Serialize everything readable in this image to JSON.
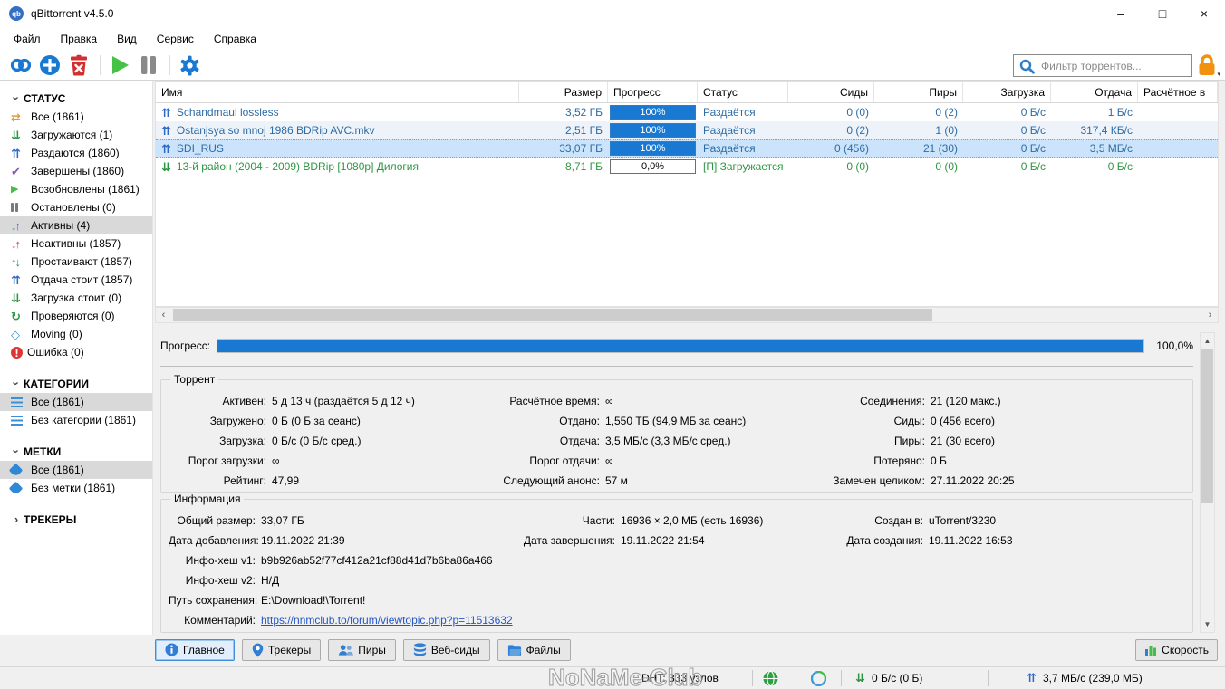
{
  "colors": {
    "accent": "#1878d2",
    "selection": "#cce4fb",
    "seeding_text": "#2d6ca5",
    "downloading_text": "#2e9642",
    "lock": "#f0920e"
  },
  "titlebar": {
    "title": "qBittorrent v4.5.0",
    "minimize": "–",
    "maximize": "□",
    "close": "×"
  },
  "menu": {
    "items": [
      "Файл",
      "Правка",
      "Вид",
      "Сервис",
      "Справка"
    ]
  },
  "toolbar": {
    "filter_placeholder": "Фильтр торрентов..."
  },
  "sidebar": {
    "status_header": "СТАТУС",
    "categories_header": "КАТЕГОРИИ",
    "tags_header": "МЕТКИ",
    "trackers_header": "ТРЕКЕРЫ",
    "status_items": [
      {
        "icon": "shuffle",
        "label": "Все (1861)"
      },
      {
        "icon": "chevrons-down",
        "label": "Загружаются (1)"
      },
      {
        "icon": "chevrons-up",
        "label": "Раздаются (1860)"
      },
      {
        "icon": "check",
        "label": "Завершены (1860)"
      },
      {
        "icon": "play",
        "label": "Возобновлены (1861)"
      },
      {
        "icon": "pause",
        "label": "Остановлены (0)"
      },
      {
        "icon": "arrows-active",
        "label": "Активны (4)",
        "selected": true
      },
      {
        "icon": "arrows-inactive",
        "label": "Неактивны (1857)"
      },
      {
        "icon": "arrows-idle",
        "label": "Простаивают (1857)"
      },
      {
        "icon": "chevrons-up",
        "label": "Отдача стоит (1857)"
      },
      {
        "icon": "chevrons-down",
        "label": "Загрузка стоит (0)"
      },
      {
        "icon": "refresh",
        "label": "Проверяются (0)"
      },
      {
        "icon": "diamond",
        "label": "Moving (0)"
      },
      {
        "icon": "error",
        "label": "Ошибка (0)"
      }
    ],
    "category_items": [
      {
        "icon": "list",
        "label": "Все (1861)",
        "selected": true
      },
      {
        "icon": "list",
        "label": "Без категории (1861)"
      }
    ],
    "tag_items": [
      {
        "icon": "tag",
        "label": "Все (1861)",
        "selected": true
      },
      {
        "icon": "tag",
        "label": "Без метки (1861)"
      }
    ]
  },
  "table": {
    "columns": [
      "Имя",
      "Размер",
      "Прогресс",
      "Статус",
      "Сиды",
      "Пиры",
      "Загрузка",
      "Отдача",
      "Расчётное в"
    ],
    "rows": [
      {
        "name": "Schandmaul lossless",
        "size": "3,52 ГБ",
        "progress": "100%",
        "status": "Раздаётся",
        "seeds": "0 (0)",
        "peers": "0 (2)",
        "down": "0 Б/с",
        "up": "1 Б/с",
        "eta": ""
      },
      {
        "name": "Ostanjsya so mnoj 1986 BDRip AVC.mkv",
        "size": "2,51 ГБ",
        "progress": "100%",
        "status": "Раздаётся",
        "seeds": "0 (2)",
        "peers": "1 (0)",
        "down": "0 Б/с",
        "up": "317,4 КБ/с",
        "eta": ""
      },
      {
        "name": "SDI_RUS",
        "size": "33,07 ГБ",
        "progress": "100%",
        "status": "Раздаётся",
        "seeds": "0 (456)",
        "peers": "21 (30)",
        "down": "0 Б/с",
        "up": "3,5 МБ/с",
        "eta": ""
      },
      {
        "name": "13-й район (2004 - 2009) BDRip [1080p] Дилогия",
        "size": "8,71 ГБ",
        "progress": "0,0%",
        "status": "[П] Загружается",
        "seeds": "0 (0)",
        "peers": "0 (0)",
        "down": "0 Б/с",
        "up": "0 Б/с",
        "eta": ""
      }
    ]
  },
  "details": {
    "progress_label": "Прогресс:",
    "progress_text": "100,0%",
    "torrent_group": {
      "title": "Торрент",
      "rows": [
        {
          "l1": "Активен:",
          "v1": "5 д 13 ч (раздаётся 5 д 12 ч)",
          "l2": "Расчётное время:",
          "v2": "∞",
          "l3": "Соединения:",
          "v3": "21 (120 макс.)"
        },
        {
          "l1": "Загружено:",
          "v1": "0 Б (0 Б за сеанс)",
          "l2": "Отдано:",
          "v2": "1,550 ТБ (94,9 МБ за сеанс)",
          "l3": "Сиды:",
          "v3": "0 (456 всего)"
        },
        {
          "l1": "Загрузка:",
          "v1": "0 Б/с (0 Б/с сред.)",
          "l2": "Отдача:",
          "v2": "3,5 МБ/с (3,3 МБ/с сред.)",
          "l3": "Пиры:",
          "v3": "21 (30 всего)"
        },
        {
          "l1": "Порог загрузки:",
          "v1": "∞",
          "l2": "Порог отдачи:",
          "v2": "∞",
          "l3": "Потеряно:",
          "v3": "0 Б"
        },
        {
          "l1": "Рейтинг:",
          "v1": "47,99",
          "l2": "Следующий анонс:",
          "v2": "57 м",
          "l3": "Замечен целиком:",
          "v3": "27.11.2022 20:25"
        }
      ]
    },
    "info_group": {
      "title": "Информация",
      "rows3col": [
        {
          "l1": "Общий размер:",
          "v1": "33,07 ГБ",
          "l2": "Части:",
          "v2": "16936 × 2,0 МБ (есть 16936)",
          "l3": "Создан в:",
          "v3": "uTorrent/3230"
        },
        {
          "l1": "Дата добавления:",
          "v1": "19.11.2022 21:39",
          "l2": "Дата завершения:",
          "v2": "19.11.2022 21:54",
          "l3": "Дата создания:",
          "v3": "19.11.2022 16:53"
        }
      ],
      "rows1col": [
        {
          "l": "Инфо-хеш v1:",
          "v": "b9b926ab52f77cf412a21cf88d41d7b6ba86a466"
        },
        {
          "l": "Инфо-хеш v2:",
          "v": "Н/Д"
        },
        {
          "l": "Путь сохранения:",
          "v": "E:\\Download!\\Torrent!"
        }
      ],
      "comment_label": "Комментарий:",
      "comment_link": "https://nnmclub.to/forum/viewtopic.php?p=11513632"
    }
  },
  "bottom_tabs": [
    {
      "icon": "info",
      "label": "Главное",
      "selected": true
    },
    {
      "icon": "pin",
      "label": "Трекеры"
    },
    {
      "icon": "peers",
      "label": "Пиры"
    },
    {
      "icon": "webseeds",
      "label": "Веб-сиды"
    },
    {
      "icon": "files",
      "label": "Файлы"
    }
  ],
  "speed_button": {
    "label": "Скорость"
  },
  "statusbar": {
    "watermark": "NoNaMe-Club",
    "dht": "DHT: 333 узлов",
    "down_speed": "0 Б/с (0 Б)",
    "up_speed": "3,7 МБ/с (239,0 МБ)"
  }
}
